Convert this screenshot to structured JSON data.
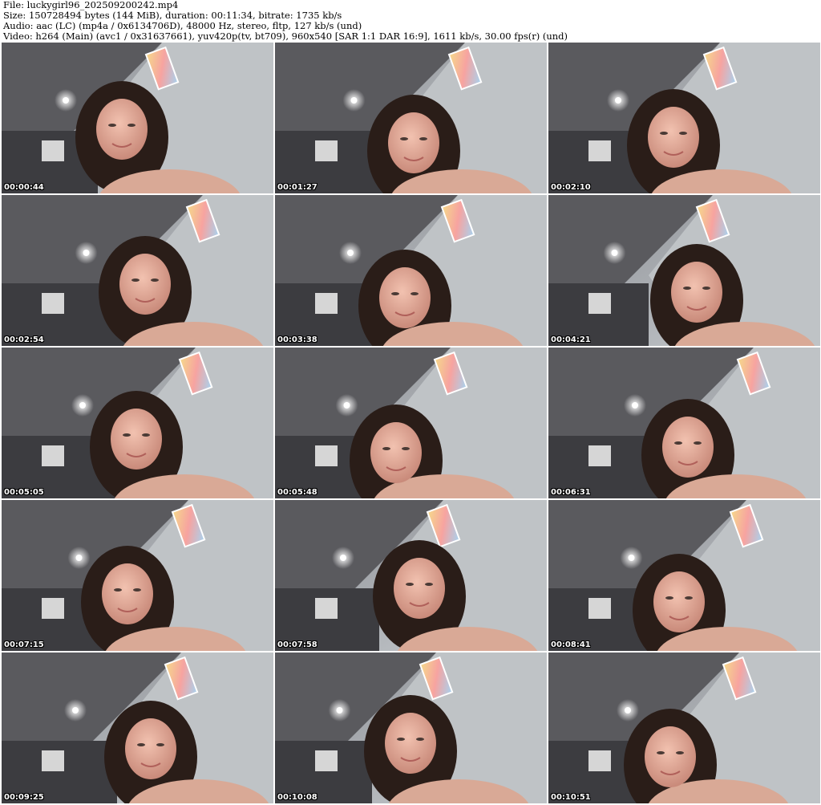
{
  "header": {
    "file_line": "File: luckygirl96_202509200242.mp4",
    "size_line": "Size: 150728494 bytes (144 MiB), duration: 00:11:34, bitrate: 1735 kb/s",
    "audio_line": "Audio: aac (LC) (mp4a / 0x6134706D), 48000 Hz, stereo, fltp, 127 kb/s (und)",
    "video_line": "Video: h264 (Main) (avc1 / 0x31637661), yuv420p(tv, bt709), 960x540 [SAR 1:1 DAR 16:9], 1611 kb/s, 30.00 fps(r) (und)"
  },
  "thumbnails": [
    {
      "timestamp": "00:00:44"
    },
    {
      "timestamp": "00:01:27"
    },
    {
      "timestamp": "00:02:10"
    },
    {
      "timestamp": "00:02:54"
    },
    {
      "timestamp": "00:03:38"
    },
    {
      "timestamp": "00:04:21"
    },
    {
      "timestamp": "00:05:05"
    },
    {
      "timestamp": "00:05:48"
    },
    {
      "timestamp": "00:06:31"
    },
    {
      "timestamp": "00:07:15"
    },
    {
      "timestamp": "00:07:58"
    },
    {
      "timestamp": "00:08:41"
    },
    {
      "timestamp": "00:09:25"
    },
    {
      "timestamp": "00:10:08"
    },
    {
      "timestamp": "00:10:51"
    }
  ]
}
